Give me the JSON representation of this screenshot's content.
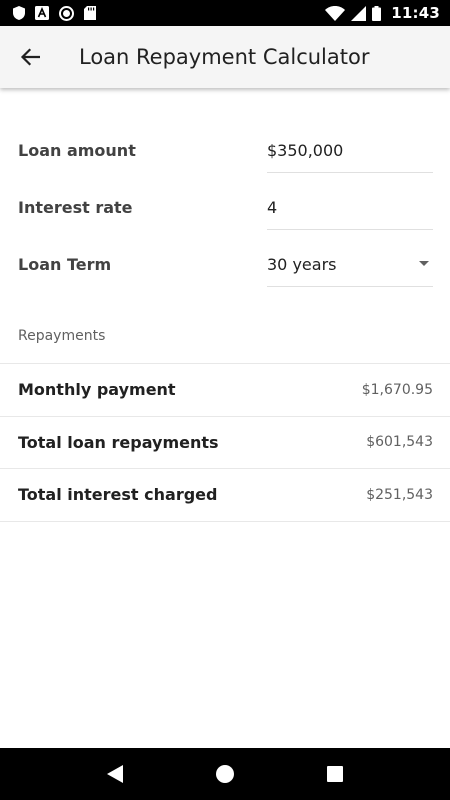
{
  "status_bar": {
    "time": "11:43",
    "left_icons": [
      "shield-icon",
      "font-a-icon",
      "circle-record-icon",
      "sd-card-icon"
    ],
    "right_icons": [
      "wifi-icon",
      "signal-icon",
      "battery-icon"
    ]
  },
  "app_bar": {
    "title": "Loan Repayment Calculator",
    "back_icon": "arrow-left-icon"
  },
  "form": {
    "loan_amount": {
      "label": "Loan amount",
      "value": "$350,000"
    },
    "interest_rate": {
      "label": "Interest rate",
      "value": "4"
    },
    "loan_term": {
      "label": "Loan Term",
      "value": "30 years",
      "icon": "dropdown-arrow-icon"
    }
  },
  "repayments": {
    "header": "Repayments",
    "rows": [
      {
        "label": "Monthly payment",
        "value": "$1,670.95"
      },
      {
        "label": "Total loan repayments",
        "value": "$601,543"
      },
      {
        "label": "Total interest charged",
        "value": "$251,543"
      }
    ]
  },
  "nav_bar": {
    "icons": [
      "nav-back-icon",
      "nav-home-icon",
      "nav-recents-icon"
    ]
  },
  "colors": {
    "status_bar": "#000000",
    "app_bar": "#f5f5f5",
    "divider": "#e0e0e0",
    "text_primary": "#212121",
    "text_secondary": "#616161"
  }
}
